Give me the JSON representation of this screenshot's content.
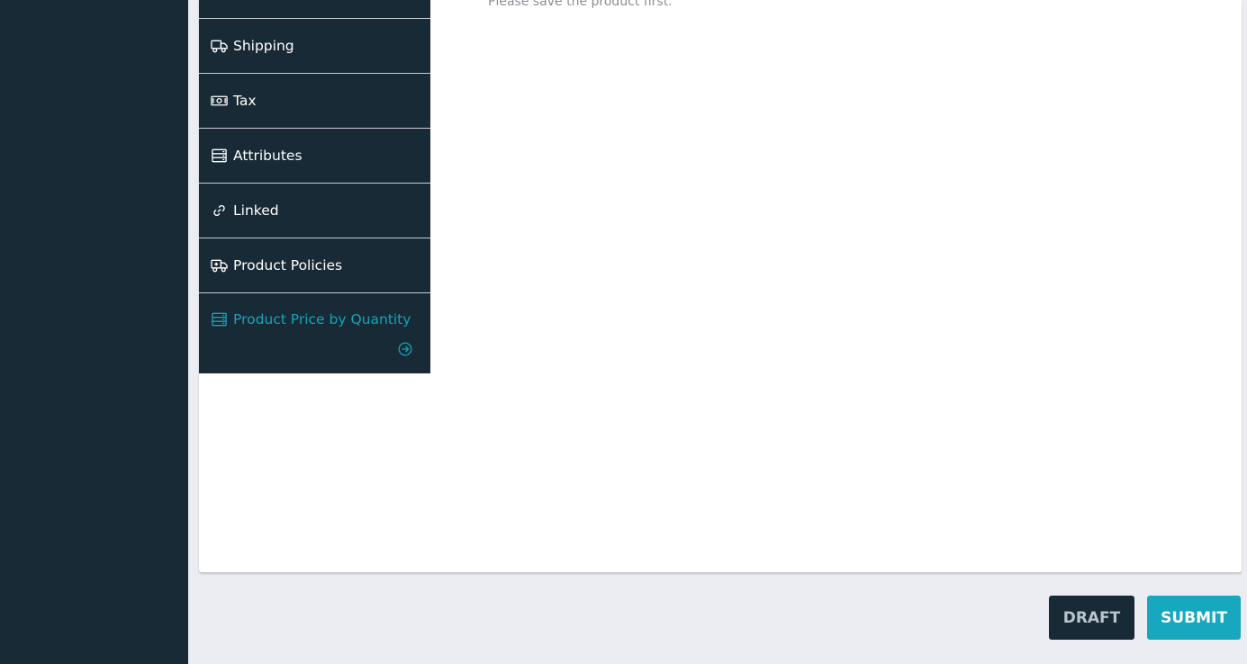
{
  "notice": "Please save the product first.",
  "tabs": [
    {
      "label": "Shipping",
      "icon": "truck-icon"
    },
    {
      "label": "Tax",
      "icon": "money-icon"
    },
    {
      "label": "Attributes",
      "icon": "server-icon"
    },
    {
      "label": "Linked",
      "icon": "link-icon"
    },
    {
      "label": "Product Policies",
      "icon": "ambulance-icon"
    },
    {
      "label": "Product Price by Quantity",
      "icon": "server-icon"
    }
  ],
  "actions": {
    "draft_label": "DRAFT",
    "submit_label": "SUBMIT"
  },
  "colors": {
    "sidebar_bg": "#182a36",
    "accent": "#17a8bf",
    "page_bg": "#ebedf2"
  }
}
